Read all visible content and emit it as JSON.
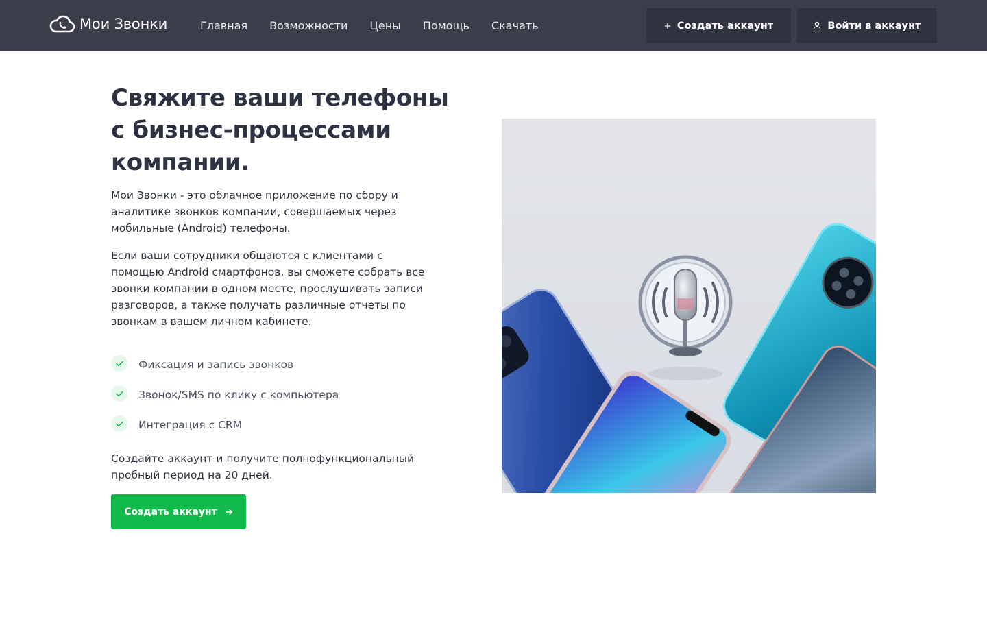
{
  "brand": {
    "name": "Мои Звонки",
    "logo_icon": "cloud-phone-icon"
  },
  "nav": {
    "items": [
      {
        "label": "Главная"
      },
      {
        "label": "Возможности"
      },
      {
        "label": "Цены"
      },
      {
        "label": "Помощь"
      },
      {
        "label": "Скачать"
      }
    ]
  },
  "header_actions": {
    "create_account": {
      "label": "Создать аккаунт",
      "icon": "plus-icon"
    },
    "login": {
      "label": "Войти в аккаунт",
      "icon": "user-icon"
    }
  },
  "hero": {
    "title": "Свяжите ваши телефоны с бизнес-процессами компании.",
    "paragraph1": "Мои Звонки - это облачное приложение по сбору и аналитике звонков компании, совершаемых через мобильные (Android) телефоны.",
    "paragraph2": "Если ваши сотрудники общаются с клиентами с помощью Android смартфонов, вы сможете собрать все звонки компании в одном месте, прослушивать записи разговоров, а также получать различные отчеты по звонкам в вашем личном кабинете.",
    "features": [
      {
        "label": "Фиксация и запись звонков",
        "icon": "check-icon"
      },
      {
        "label": "Звонок/SMS по клику с компьютера",
        "icon": "check-icon"
      },
      {
        "label": "Интеграция с CRM",
        "icon": "check-icon"
      }
    ],
    "trial_text": "Создайте аккаунт и получите полнофункциональный пробный период на 20 дней.",
    "cta": {
      "label": "Создать аккаунт",
      "icon": "arrow-right-icon"
    },
    "image": {
      "subject": "smartphones-with-microphone-illustration"
    }
  },
  "colors": {
    "header_bg": "#3c3d4a",
    "header_button_bg": "#313240",
    "accent_green": "#10b94a",
    "heading_text": "#2d3342"
  }
}
